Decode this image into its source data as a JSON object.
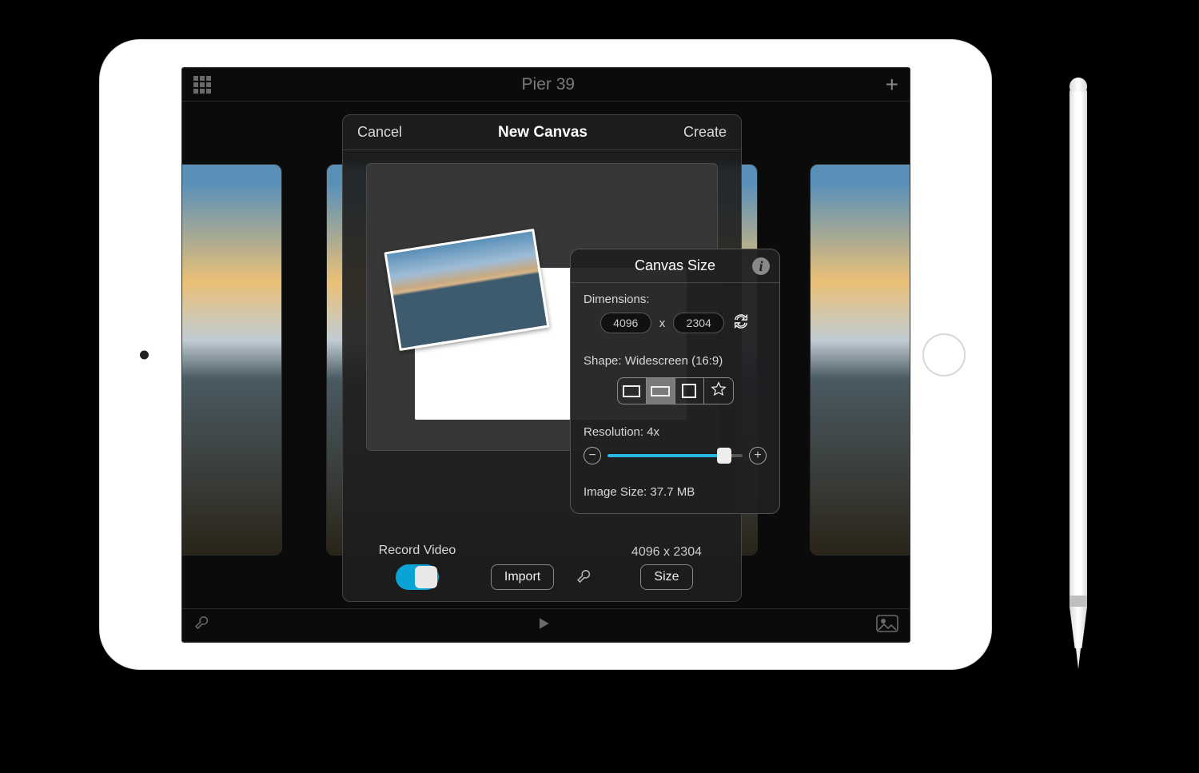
{
  "topbar": {
    "title": "Pier 39"
  },
  "modal": {
    "cancel": "Cancel",
    "title": "New Canvas",
    "create": "Create",
    "record_label": "Record Video",
    "import_label": "Import",
    "size_label": "Size",
    "dims_text": "4096 x 2304"
  },
  "popover": {
    "title": "Canvas Size",
    "dimensions_label": "Dimensions:",
    "width": "4096",
    "x": "x",
    "height": "2304",
    "shape_label": "Shape: Widescreen (16:9)",
    "resolution_label": "Resolution: 4x",
    "image_size_label": "Image Size: 37.7 MB"
  }
}
